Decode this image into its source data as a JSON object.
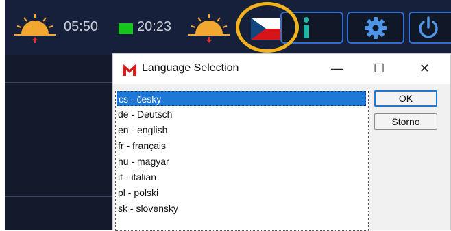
{
  "toolbar": {
    "sunrise_time": "05:50",
    "sunset_time": "20:23",
    "sunrise_icon": "sunrise-icon",
    "sunset_icon": "sunset-icon",
    "language_flag_icon": "czech-flag-icon",
    "info_icon": "info-icon",
    "settings_icon": "gear-icon",
    "power_icon": "power-icon",
    "accent_color": "#2f6fd0",
    "highlight_ring_color": "#f2b21d"
  },
  "dialog": {
    "title": "Language Selection",
    "minimize": "—",
    "maximize": "☐",
    "close": "✕",
    "languages": [
      "cs - česky",
      "de - Deutsch",
      "en - english",
      "fr - français",
      "hu - magyar",
      "it - italian",
      "pl - polski",
      "sk - slovensky"
    ],
    "selected_index": 0,
    "ok_label": "OK",
    "cancel_label": "Storno"
  }
}
